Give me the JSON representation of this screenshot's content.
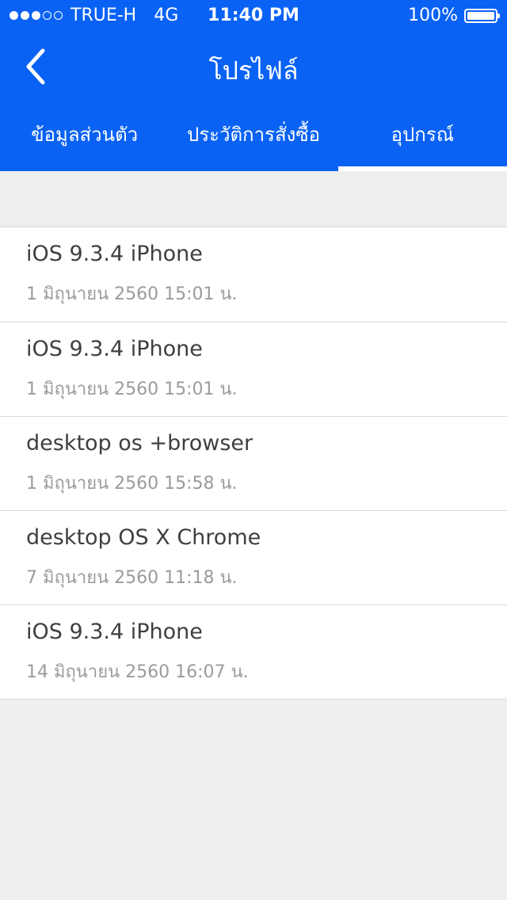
{
  "status_bar": {
    "signal_filled": 3,
    "signal_total": 5,
    "carrier": "TRUE-H",
    "network": "4G",
    "time": "11:40 PM",
    "battery_text": "100%",
    "battery_level": 1.0
  },
  "nav": {
    "back_icon": "chevron-left-icon",
    "title": "โปรไฟล์"
  },
  "tabs": [
    {
      "label": "ข้อมูลส่วนตัว",
      "active": false
    },
    {
      "label": "ประวัติการสั่งซื้อ",
      "active": false
    },
    {
      "label": "อุปกรณ์",
      "active": true
    }
  ],
  "devices": [
    {
      "name": "iOS 9.3.4 iPhone",
      "date": "1 มิถุนายน 2560 15:01 น."
    },
    {
      "name": "iOS 9.3.4 iPhone",
      "date": "1 มิถุนายน 2560 15:01 น."
    },
    {
      "name": "desktop os +browser",
      "date": "1 มิถุนายน 2560 15:58 น."
    },
    {
      "name": "desktop OS X Chrome",
      "date": "7 มิถุนายน 2560 11:18 น."
    },
    {
      "name": "iOS 9.3.4 iPhone",
      "date": "14 มิถุนายน 2560 16:07 น."
    }
  ],
  "colors": {
    "brand_blue": "#0a62f5",
    "background": "#efefef",
    "primary_text": "#3f3f3f",
    "secondary_text": "#9b9b9b"
  }
}
